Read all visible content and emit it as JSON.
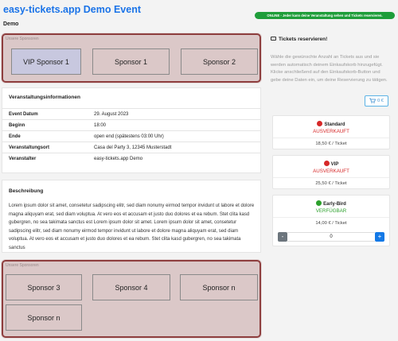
{
  "header": {
    "title": "easy-tickets.app Demo Event",
    "subtitle": "Demo",
    "online_badge": "ONLINE - Jeder kann deine Veranstaltung sehen und Tickets reservieren."
  },
  "sponsors_top": {
    "caption": "Unsere Sponsoren",
    "items": [
      "VIP Sponsor 1",
      "Sponsor 1",
      "Sponsor 2"
    ]
  },
  "event_info": {
    "title": "Veranstaltungsinformationen",
    "rows": [
      {
        "label": "Event Datum",
        "value": "29. August 2023"
      },
      {
        "label": "Beginn",
        "value": "18:00"
      },
      {
        "label": "Ende",
        "value": "open end (spätestens 03:00 Uhr)"
      },
      {
        "label": "Veranstaltungsort",
        "value": "Casa del Party 3, 12345 Musterstadt"
      },
      {
        "label": "Veranstalter",
        "value": "easy-tickets.app Demo"
      }
    ]
  },
  "description": {
    "title": "Beschreibung",
    "text": "Lorem ipsum dolor sit amet, consetetur sadipscing elitr, sed diam nonumy eirmod tempor invidunt ut labore et dolore magna aliquyam erat, sed diam voluptua. At vero eos et accusam et justo duo dolores et ea rebum. Stet clita kasd gubergren, no sea takimata sanctus est Lorem ipsum dolor sit amet. Lorem ipsum dolor sit amet, consetetur sadipscing elitr, sed diam nonumy eirmod tempor invidunt ut labore et dolore magna aliquyam erat, sed diam voluptua. At vero eos et accusam et justo duo dolores et ea rebum. Stet clita kasd gubergren, no sea takimata sanctus"
  },
  "sponsors_bottom": {
    "caption": "Unsere Sponsoren",
    "items": [
      "Sponsor 3",
      "Sponsor 4",
      "Sponsor n",
      "Sponsor n"
    ]
  },
  "tickets": {
    "header": "Tickets reservieren!",
    "header_icon": "ticket-icon",
    "description": "Wähle die gewünschte Anzahl an Tickets aus und sie werden automatisch deinem Einkaufskorb hinzugefügt. Klicke anschließend auf den Einkaufskorb-Button und gebe deine Daten ein, um deine Reservierung zu tätigen.",
    "cart_label": "0 €",
    "cart_icon": "cart-icon",
    "items": [
      {
        "name": "Standard",
        "status": "AUSVERKAUFT",
        "price": "18,50 € / Ticket",
        "dot_color": "#d62828",
        "status_color": "#d62828"
      },
      {
        "name": "VIP",
        "status": "AUSVERKAUFT",
        "price": "25,50 € / Ticket",
        "dot_color": "#d62828",
        "status_color": "#d62828"
      },
      {
        "name": "Early-Bird",
        "status": "VERFÜGBAR",
        "price": "14,00 € / Ticket",
        "dot_color": "#2ca02c",
        "status_color": "#2ca02c"
      }
    ],
    "stepper": {
      "minus": "-",
      "value": "0",
      "plus": "+"
    }
  },
  "colors": {
    "accent_blue": "#1a73e8",
    "online_green": "#1f9d3a",
    "sponsor_border": "#8e3e3e",
    "sponsor_fill": "#dbc8c8",
    "plus_button": "#1479e6",
    "minus_button": "#6c757d"
  }
}
